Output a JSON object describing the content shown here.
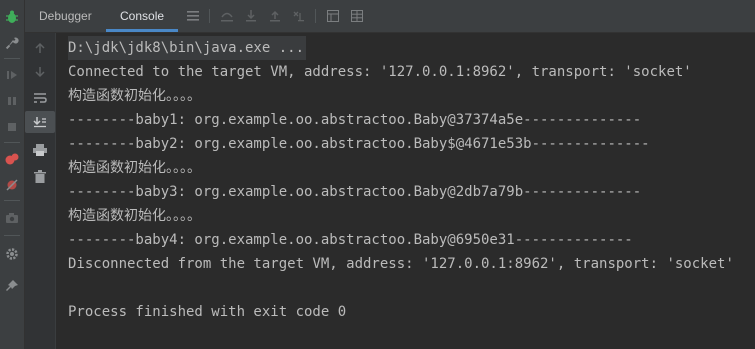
{
  "tabs": [
    {
      "label": "Debugger"
    },
    {
      "label": "Console"
    }
  ],
  "icons": {
    "left": [
      "bug-icon",
      "wrench-icon",
      "resume-icon",
      "pause-icon",
      "stop-icon",
      "view-breakpoints-icon",
      "mute-breakpoints-icon",
      "camera-icon",
      "settings-icon",
      "pin-icon"
    ],
    "gutter": [
      "up-arrow-icon",
      "down-arrow-icon",
      "soft-wrap-icon",
      "scroll-to-end-icon",
      "print-icon",
      "trash-icon"
    ],
    "toolbar": [
      "menu-icon",
      "step-over-icon",
      "step-into-icon",
      "step-out-icon",
      "step-cursor-icon",
      "table-icon",
      "grid-icon"
    ]
  },
  "console": {
    "lines": [
      "D:\\jdk\\jdk8\\bin\\java.exe ...",
      "Connected to the target VM, address: '127.0.0.1:8962', transport: 'socket'",
      "构造函数初始化。。。。",
      "--------baby1: org.example.oo.abstractoo.Baby@37374a5e--------------",
      "--------baby2: org.example.oo.abstractoo.Baby$@4671e53b--------------",
      "构造函数初始化。。。。",
      "--------baby3: org.example.oo.abstractoo.Baby@2db7a79b--------------",
      "构造函数初始化。。。。",
      "--------baby4: org.example.oo.abstractoo.Baby@6950e31--------------",
      "Disconnected from the target VM, address: '127.0.0.1:8962', transport: 'socket'",
      "",
      "Process finished with exit code 0"
    ]
  },
  "colors": {
    "background": "#2b2b2b",
    "text": "#bbbbbb",
    "accent": "#4a88c7",
    "bug_icon": "#3fae5a",
    "breakpoint": "#d9534f"
  }
}
